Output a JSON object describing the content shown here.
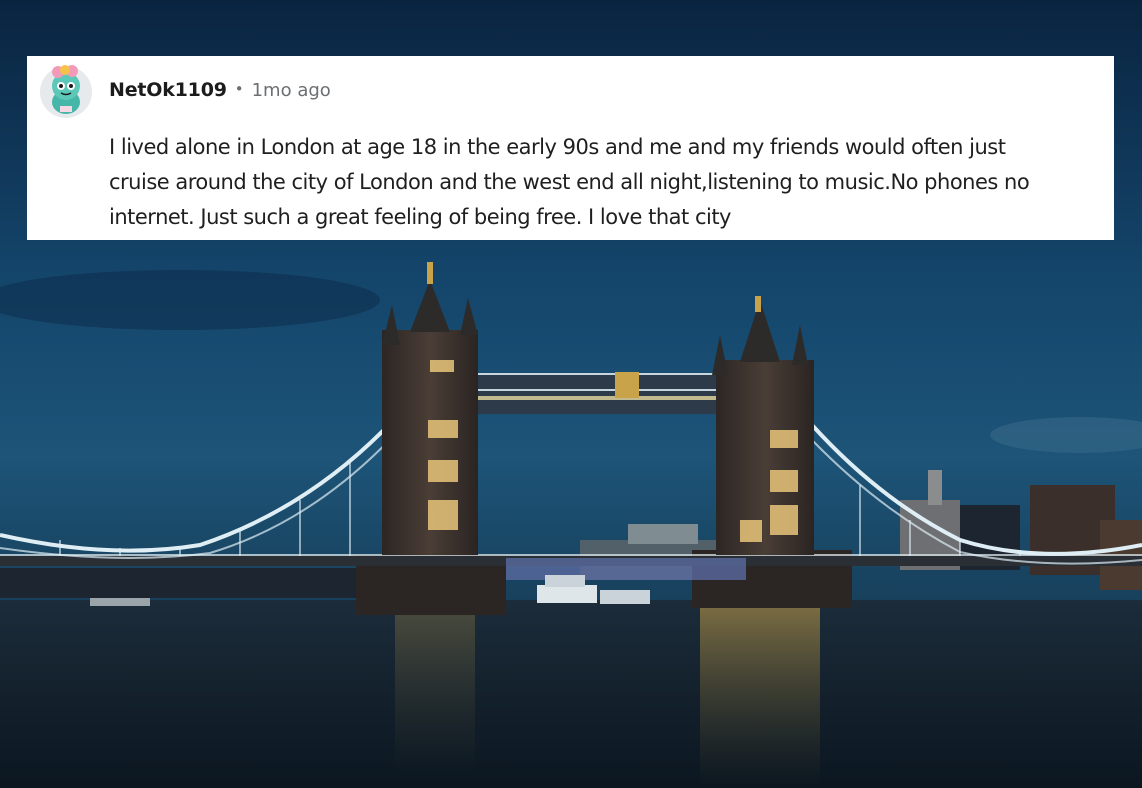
{
  "comment": {
    "username": "NetOk1109",
    "separator": "•",
    "timestamp": "1mo ago",
    "text_lines": [
      "I lived alone in London at age 18 in the early 90s and me and my friends would often just",
      "cruise around the city of London and the west end all night,listening to music.No phones no",
      "internet. Just such a great feeling of being free. I love that city"
    ],
    "avatar_icon": "snoo-avatar-icon"
  },
  "background": {
    "subject": "tower-bridge-night-photo",
    "colors": {
      "sky_top": "#0a2a4d",
      "sky_mid": "#1a4a72",
      "water": "#10202e",
      "stone": "#3a3330",
      "cable": "#dfeef5",
      "lights": "#f2c15a"
    }
  }
}
